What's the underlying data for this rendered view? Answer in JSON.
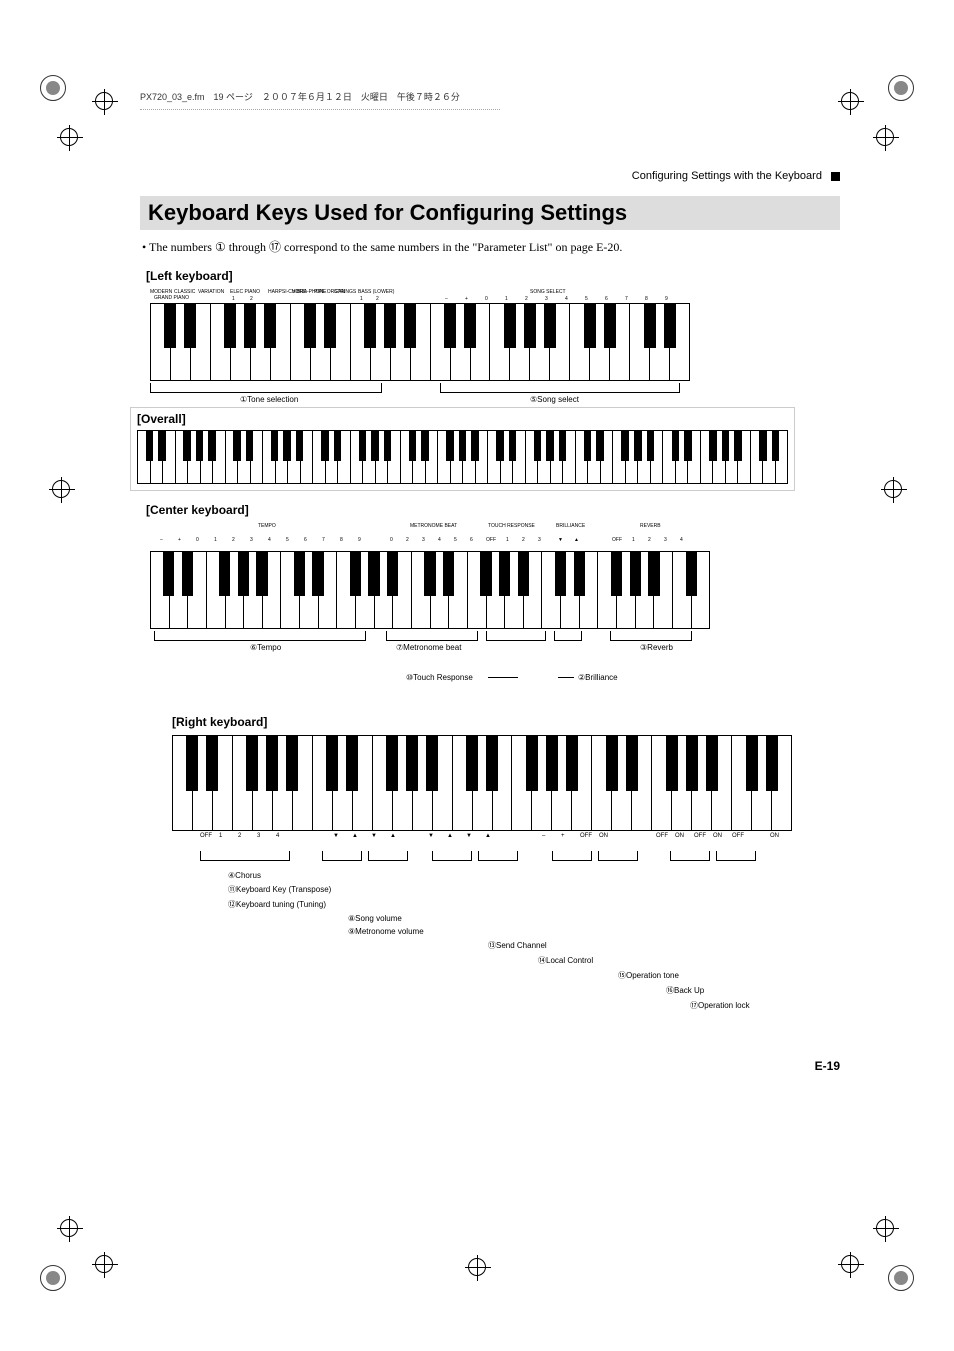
{
  "fm_header": "PX720_03_e.fm　19 ページ　２００７年６月１２日　火曜日　午後７時２６分",
  "running_header": "Configuring Settings with the Keyboard",
  "title": "Keyboard Keys Used for Configuring Settings",
  "intro_bullet": "• The numbers ① through ⑰ correspond to the same numbers in the \"Parameter List\" on page E-20.",
  "sections": {
    "left": "[Left keyboard]",
    "overall": "[Overall]",
    "center": "[Center keyboard]",
    "right": "[Right keyboard]"
  },
  "left_kb": {
    "top_group_left": "GRAND PIANO",
    "tones": [
      "MODERN",
      "CLASSIC",
      "VARIATION"
    ],
    "elec_piano": "ELEC PIANO",
    "ep_nums": [
      "1",
      "2"
    ],
    "others": [
      "HARPSI-CHORD",
      "VIBRA-PHONE",
      "PIPE ORGAN",
      "STRINGS"
    ],
    "bass": "BASS (LOWER)",
    "bass_nums": [
      "1",
      "2"
    ],
    "song_select": "SONG SELECT",
    "song_nums": [
      "–",
      "+",
      "0",
      "1",
      "2",
      "3",
      "4",
      "5",
      "6",
      "7",
      "8",
      "9"
    ],
    "callout1": "①Tone selection",
    "callout5": "⑤Song select"
  },
  "center_kb": {
    "tempo": "TEMPO",
    "tempo_nums": [
      "–",
      "+",
      "0",
      "1",
      "2",
      "3",
      "4",
      "5",
      "6",
      "7",
      "8",
      "9"
    ],
    "metro": "METRONOME BEAT",
    "metro_nums": [
      "0",
      "2",
      "3",
      "4",
      "5",
      "6"
    ],
    "touch": "TOUCH RESPONSE",
    "touch_nums": [
      "OFF",
      "1",
      "2",
      "3"
    ],
    "brill": "BRILLIANCE",
    "brill_nums": [
      "▼",
      "▲"
    ],
    "reverb": "REVERB",
    "reverb_nums": [
      "OFF",
      "1",
      "2",
      "3",
      "4"
    ],
    "callout6": "⑥Tempo",
    "callout7": "⑦Metronome beat",
    "callout3": "③Reverb",
    "callout10": "⑩Touch Response",
    "callout2": "②Brilliance"
  },
  "right_kb": {
    "under": [
      "OFF",
      "1",
      "2",
      "3",
      "4",
      "",
      "",
      "▼",
      "▲",
      "▼",
      "▲",
      "",
      "▼",
      "▲",
      "▼",
      "▲",
      "",
      "",
      "–",
      "+",
      "OFF",
      "ON",
      "",
      "",
      "OFF",
      "ON",
      "OFF",
      "ON",
      "OFF",
      "",
      "ON"
    ],
    "annos": [
      "④Chorus",
      "⑪Keyboard Key (Transpose)",
      "⑫Keyboard tuning (Tuning)",
      "⑧Song volume",
      "⑨Metronome volume",
      "⑬Send Channel",
      "⑭Local Control",
      "⑮Operation tone",
      "⑯Back Up",
      "⑰Operation lock"
    ]
  },
  "page_number": "E-19"
}
